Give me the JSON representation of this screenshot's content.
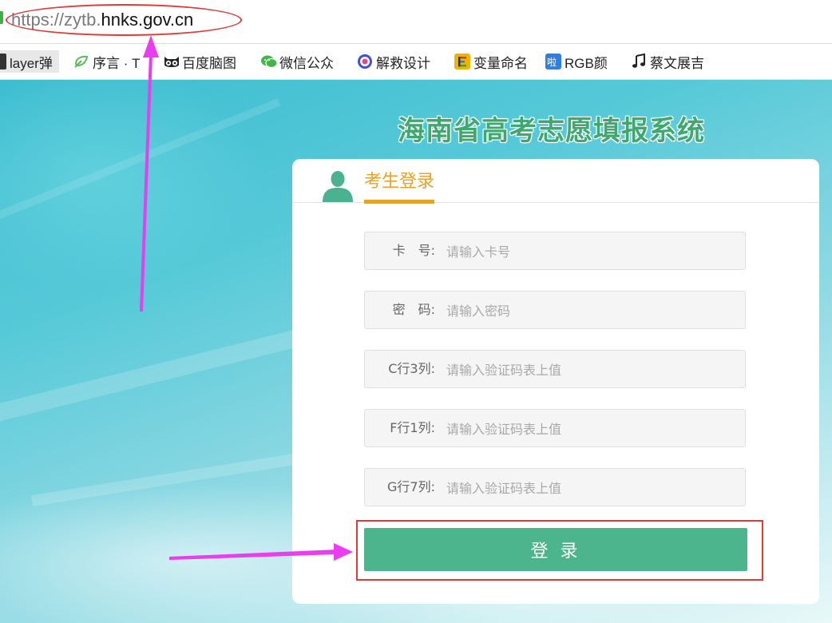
{
  "browser": {
    "url": {
      "scheme_part": "https://zytb.",
      "host_part": "hnks.gov.cn"
    },
    "bookmarks": [
      {
        "label": "layer弹",
        "icon": "layer-icon",
        "color": "#333333"
      },
      {
        "label": "序言 · T",
        "icon": "leaf-icon",
        "color": "#5cb85c"
      },
      {
        "label": "百度脑图",
        "icon": "owl-icon",
        "color": "#222222"
      },
      {
        "label": "微信公众",
        "icon": "wechat-icon",
        "color": "#44b549"
      },
      {
        "label": "解救设计",
        "icon": "circle-logo-icon",
        "color": "#3f51d8"
      },
      {
        "label": "变量命名",
        "icon": "e-logo-icon",
        "color": "#f0b400"
      },
      {
        "label": "RGB颜",
        "icon": "color-logo-icon",
        "color": "#2f7fe0"
      },
      {
        "label": "蔡文展吉",
        "icon": "music-note-icon",
        "color": "#222222"
      }
    ]
  },
  "page": {
    "title": "海南省高考志愿填报系统",
    "login": {
      "heading": "考生登录",
      "fields": [
        {
          "label": "卡　号:",
          "placeholder": "请输入卡号",
          "value": ""
        },
        {
          "label": "密　码:",
          "placeholder": "请输入密码",
          "value": ""
        },
        {
          "label": "C行3列:",
          "placeholder": "请输入验证码表上值",
          "value": ""
        },
        {
          "label": "F行1列:",
          "placeholder": "请输入验证码表上值",
          "value": ""
        },
        {
          "label": "G行7列:",
          "placeholder": "请输入验证码表上值",
          "value": ""
        }
      ],
      "submit_label": "登 录"
    }
  },
  "colors": {
    "accent_green": "#4db58e",
    "title_green": "#3fa86f",
    "heading_orange": "#e6a22a",
    "annotation_red": "#e03a3a",
    "annotation_arrow": "#e83ef0"
  }
}
